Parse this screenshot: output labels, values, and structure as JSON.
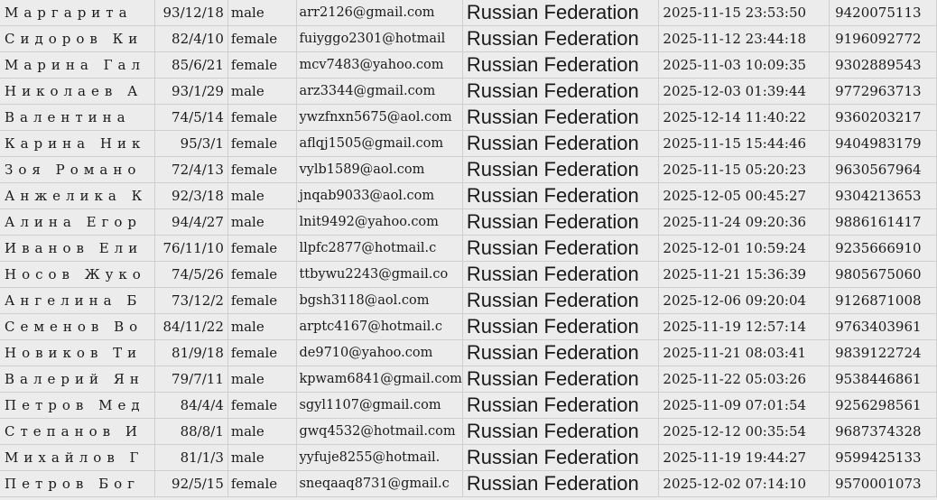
{
  "sheet": {
    "rows": [
      {
        "name": "Маргарита",
        "dob": "93/12/18",
        "gender": "male",
        "email": "arr2126@gmail.com",
        "country": "Russian Federation",
        "timestamp": "2025-11-15 23:53:50",
        "phone": "9420075113"
      },
      {
        "name": "Сидоров Ки",
        "dob": "82/4/10",
        "gender": "female",
        "email": "fuiyggo2301@hotmail",
        "country": "Russian Federation",
        "timestamp": "2025-11-12 23:44:18",
        "phone": "9196092772"
      },
      {
        "name": "Марина Гал",
        "dob": "85/6/21",
        "gender": "female",
        "email": "mcv7483@yahoo.com",
        "country": "Russian Federation",
        "timestamp": "2025-11-03 10:09:35",
        "phone": "9302889543"
      },
      {
        "name": "Николаев А",
        "dob": "93/1/29",
        "gender": "male",
        "email": "arz3344@gmail.com",
        "country": "Russian Federation",
        "timestamp": "2025-12-03 01:39:44",
        "phone": "9772963713"
      },
      {
        "name": "Валентина",
        "dob": "74/5/14",
        "gender": "female",
        "email": "ywzfnxn5675@aol.com",
        "country": "Russian Federation",
        "timestamp": "2025-12-14 11:40:22",
        "phone": "9360203217"
      },
      {
        "name": "Карина Ник",
        "dob": "95/3/1",
        "gender": "female",
        "email": "aflqj1505@gmail.com",
        "country": "Russian Federation",
        "timestamp": "2025-11-15 15:44:46",
        "phone": "9404983179"
      },
      {
        "name": "Зоя Романо",
        "dob": "72/4/13",
        "gender": "female",
        "email": "vylb1589@aol.com",
        "country": "Russian Federation",
        "timestamp": "2025-11-15 05:20:23",
        "phone": "9630567964"
      },
      {
        "name": "Анжелика К",
        "dob": "92/3/18",
        "gender": "male",
        "email": "jnqab9033@aol.com",
        "country": "Russian Federation",
        "timestamp": "2025-12-05 00:45:27",
        "phone": "9304213653"
      },
      {
        "name": "Алина Егор",
        "dob": "94/4/27",
        "gender": "male",
        "email": "lnit9492@yahoo.com",
        "country": "Russian Federation",
        "timestamp": "2025-11-24 09:20:36",
        "phone": "9886161417"
      },
      {
        "name": "Иванов Ели",
        "dob": "76/11/10",
        "gender": "female",
        "email": "llpfc2877@hotmail.c",
        "country": "Russian Federation",
        "timestamp": "2025-12-01 10:59:24",
        "phone": "9235666910"
      },
      {
        "name": "Носов Жуко",
        "dob": "74/5/26",
        "gender": "female",
        "email": "ttbywu2243@gmail.co",
        "country": "Russian Federation",
        "timestamp": "2025-11-21 15:36:39",
        "phone": "9805675060"
      },
      {
        "name": "Ангелина Б",
        "dob": "73/12/2",
        "gender": "female",
        "email": "bgsh3118@aol.com",
        "country": "Russian Federation",
        "timestamp": "2025-12-06 09:20:04",
        "phone": "9126871008"
      },
      {
        "name": "Семенов Во",
        "dob": "84/11/22",
        "gender": "male",
        "email": "arptc4167@hotmail.c",
        "country": "Russian Federation",
        "timestamp": "2025-11-19 12:57:14",
        "phone": "9763403961"
      },
      {
        "name": "Новиков Ти",
        "dob": "81/9/18",
        "gender": "female",
        "email": "de9710@yahoo.com",
        "country": "Russian Federation",
        "timestamp": "2025-11-21 08:03:41",
        "phone": "9839122724"
      },
      {
        "name": "Валерий Ян",
        "dob": "79/7/11",
        "gender": "male",
        "email": "kpwam6841@gmail.com",
        "country": "Russian Federation",
        "timestamp": "2025-11-22 05:03:26",
        "phone": "9538446861"
      },
      {
        "name": "Петров Мед",
        "dob": "84/4/4",
        "gender": "female",
        "email": "sgyl1107@gmail.com",
        "country": "Russian Federation",
        "timestamp": "2025-11-09 07:01:54",
        "phone": "9256298561"
      },
      {
        "name": "Степанов И",
        "dob": "88/8/1",
        "gender": "male",
        "email": "gwq4532@hotmail.com",
        "country": "Russian Federation",
        "timestamp": "2025-12-12 00:35:54",
        "phone": "9687374328"
      },
      {
        "name": "Михайлов Г",
        "dob": "81/1/3",
        "gender": "male",
        "email": "yyfuje8255@hotmail.",
        "country": "Russian Federation",
        "timestamp": "2025-11-19 19:44:27",
        "phone": "9599425133"
      },
      {
        "name": "Петров Бог",
        "dob": "92/5/15",
        "gender": "female",
        "email": "sneqaaq8731@gmail.c",
        "country": "Russian Federation",
        "timestamp": "2025-12-02 07:14:10",
        "phone": "9570001073"
      }
    ]
  }
}
